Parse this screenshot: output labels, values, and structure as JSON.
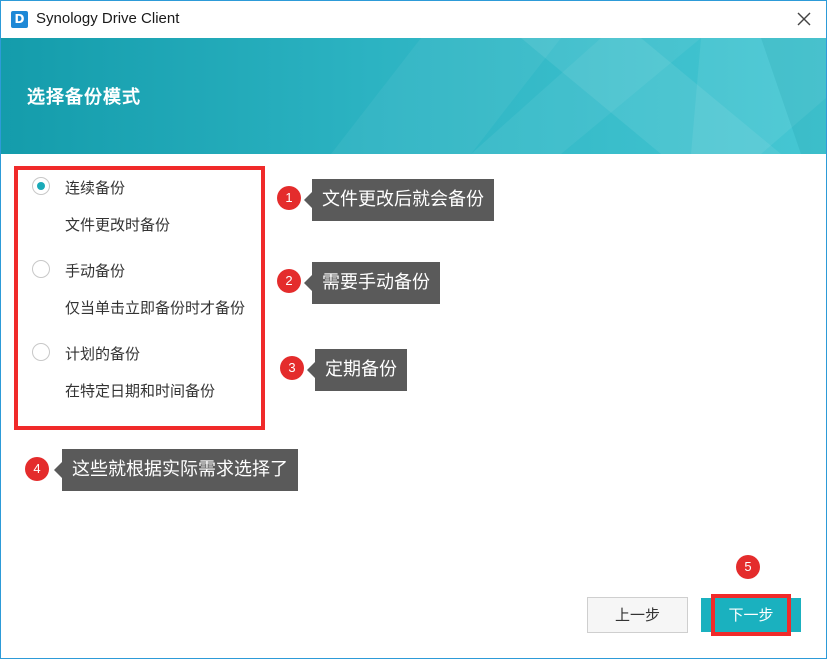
{
  "window": {
    "title": "Synology Drive Client",
    "app_icon_letter": "D"
  },
  "header": {
    "title": "选择备份模式"
  },
  "options": [
    {
      "label": "连续备份",
      "description": "文件更改时备份",
      "selected": true
    },
    {
      "label": "手动备份",
      "description": "仅当单击立即备份时才备份",
      "selected": false
    },
    {
      "label": "计划的备份",
      "description": "在特定日期和时间备份",
      "selected": false
    }
  ],
  "annotations": [
    {
      "number": "1",
      "text": "文件更改后就会备份"
    },
    {
      "number": "2",
      "text": "需要手动备份"
    },
    {
      "number": "3",
      "text": "定期备份"
    },
    {
      "number": "4",
      "text": "这些就根据实际需求选择了"
    },
    {
      "number": "5"
    }
  ],
  "buttons": {
    "prev_label": "上一步",
    "next_label": "下一步"
  },
  "colors": {
    "accent": "#1ab1bf",
    "header_start": "#149cab",
    "header_end": "#46c7d3",
    "highlight_red": "#f02a2a",
    "callout_bg": "#5a5a5a"
  }
}
